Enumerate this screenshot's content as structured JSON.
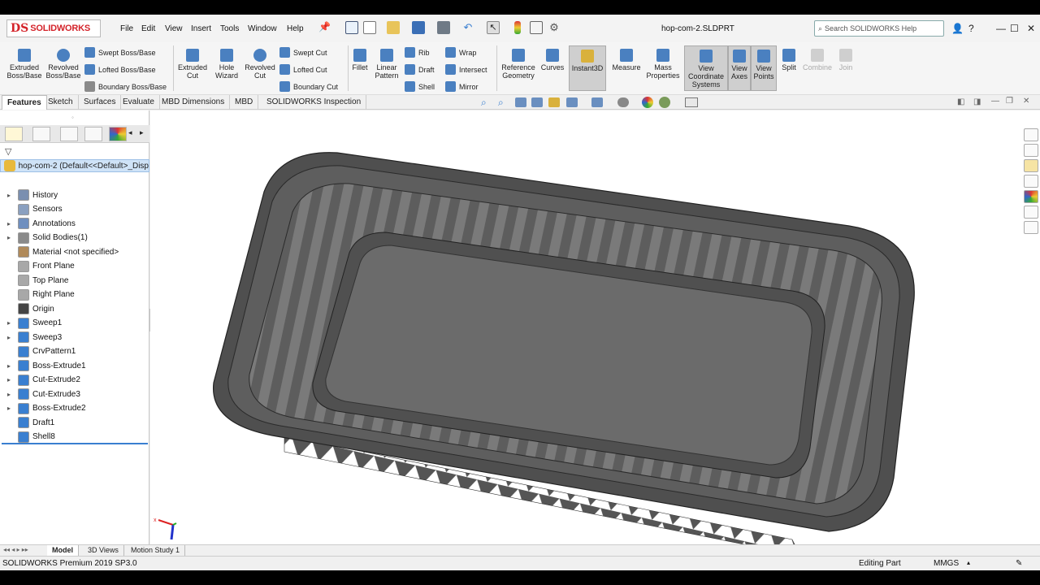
{
  "app": {
    "brand": "SOLIDWORKS",
    "document_title": "hop-com-2.SLDPRT",
    "search_placeholder": "Search SOLIDWORKS Help"
  },
  "menu": [
    "File",
    "Edit",
    "View",
    "Insert",
    "Tools",
    "Window",
    "Help"
  ],
  "ribbon": {
    "extruded_boss": "Extruded Boss/Base",
    "revolved_boss": "Revolved Boss/Base",
    "swept_boss": "Swept Boss/Base",
    "lofted_boss": "Lofted Boss/Base",
    "boundary_boss": "Boundary Boss/Base",
    "extruded_cut": "Extruded Cut",
    "hole_wizard": "Hole Wizard",
    "revolved_cut": "Revolved Cut",
    "swept_cut": "Swept Cut",
    "lofted_cut": "Lofted Cut",
    "boundary_cut": "Boundary Cut",
    "fillet": "Fillet",
    "linear_pattern": "Linear Pattern",
    "rib": "Rib",
    "draft": "Draft",
    "shell": "Shell",
    "wrap": "Wrap",
    "intersect": "Intersect",
    "mirror": "Mirror",
    "reference_geometry": "Reference Geometry",
    "curves": "Curves",
    "instant3d": "Instant3D",
    "measure": "Measure",
    "mass_properties": "Mass Properties",
    "view_coordinate_systems": "View Coordinate Systems",
    "view_axes": "View Axes",
    "view_points": "View Points",
    "split": "Split",
    "combine": "Combine",
    "join": "Join"
  },
  "command_tabs": [
    "Features",
    "Sketch",
    "Surfaces",
    "Evaluate",
    "MBD Dimensions",
    "MBD",
    "SOLIDWORKS Inspection"
  ],
  "feature_tree": {
    "root": "hop-com-2  (Default<<Default>_Disp",
    "items": [
      {
        "label": "History",
        "expandable": true
      },
      {
        "label": "Sensors",
        "expandable": false
      },
      {
        "label": "Annotations",
        "expandable": true
      },
      {
        "label": "Solid Bodies(1)",
        "expandable": true
      },
      {
        "label": "Material <not specified>",
        "expandable": false
      },
      {
        "label": "Front Plane",
        "expandable": false
      },
      {
        "label": "Top Plane",
        "expandable": false
      },
      {
        "label": "Right Plane",
        "expandable": false
      },
      {
        "label": "Origin",
        "expandable": false
      },
      {
        "label": "Sweep1",
        "expandable": true
      },
      {
        "label": "Sweep3",
        "expandable": true
      },
      {
        "label": "CrvPattern1",
        "expandable": false
      },
      {
        "label": "Boss-Extrude1",
        "expandable": true
      },
      {
        "label": "Cut-Extrude2",
        "expandable": true
      },
      {
        "label": "Cut-Extrude3",
        "expandable": true
      },
      {
        "label": "Boss-Extrude2",
        "expandable": true
      },
      {
        "label": "Draft1",
        "expandable": false
      },
      {
        "label": "Shell8",
        "expandable": false
      }
    ]
  },
  "bottom_tabs": [
    "Model",
    "3D Views",
    "Motion Study 1"
  ],
  "status": {
    "version": "SOLIDWORKS Premium 2019 SP3.0",
    "mode": "Editing Part",
    "units": "MMGS"
  },
  "colors": {
    "accent": "#3a7fd0",
    "brand_red": "#d4232a",
    "model_fill": "#6b6b6b"
  }
}
